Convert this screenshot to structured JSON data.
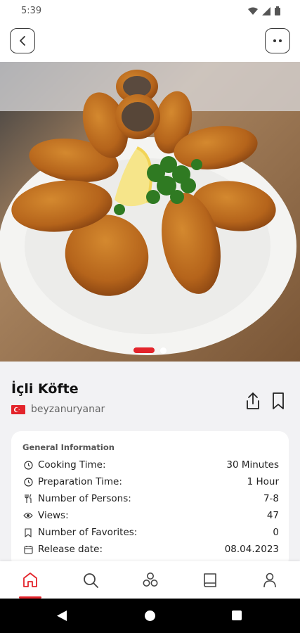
{
  "status_bar": {
    "time": "5:39"
  },
  "recipe": {
    "title": "İçli Köfte",
    "author": "beyzanuryanar",
    "image_count": 2,
    "active_image": 1
  },
  "info": {
    "heading": "General Information",
    "rows": [
      {
        "icon": "clock-icon",
        "label": "Cooking Time:",
        "value": "30 Minutes"
      },
      {
        "icon": "clock-icon",
        "label": "Preparation Time:",
        "value": "1 Hour"
      },
      {
        "icon": "utensils-icon",
        "label": "Number of Persons:",
        "value": "7-8"
      },
      {
        "icon": "eye-icon",
        "label": "Views:",
        "value": "47"
      },
      {
        "icon": "bookmark-icon",
        "label": "Number of Favorites:",
        "value": "0"
      },
      {
        "icon": "calendar-icon",
        "label": "Release date:",
        "value": "08.04.2023"
      }
    ]
  },
  "bottom_nav": {
    "items": [
      "home-icon",
      "search-icon",
      "categories-icon",
      "book-icon",
      "profile-icon"
    ],
    "active": "home-icon"
  },
  "colors": {
    "accent": "#e3242b",
    "card": "#ffffff",
    "background": "#f2f2f4"
  }
}
